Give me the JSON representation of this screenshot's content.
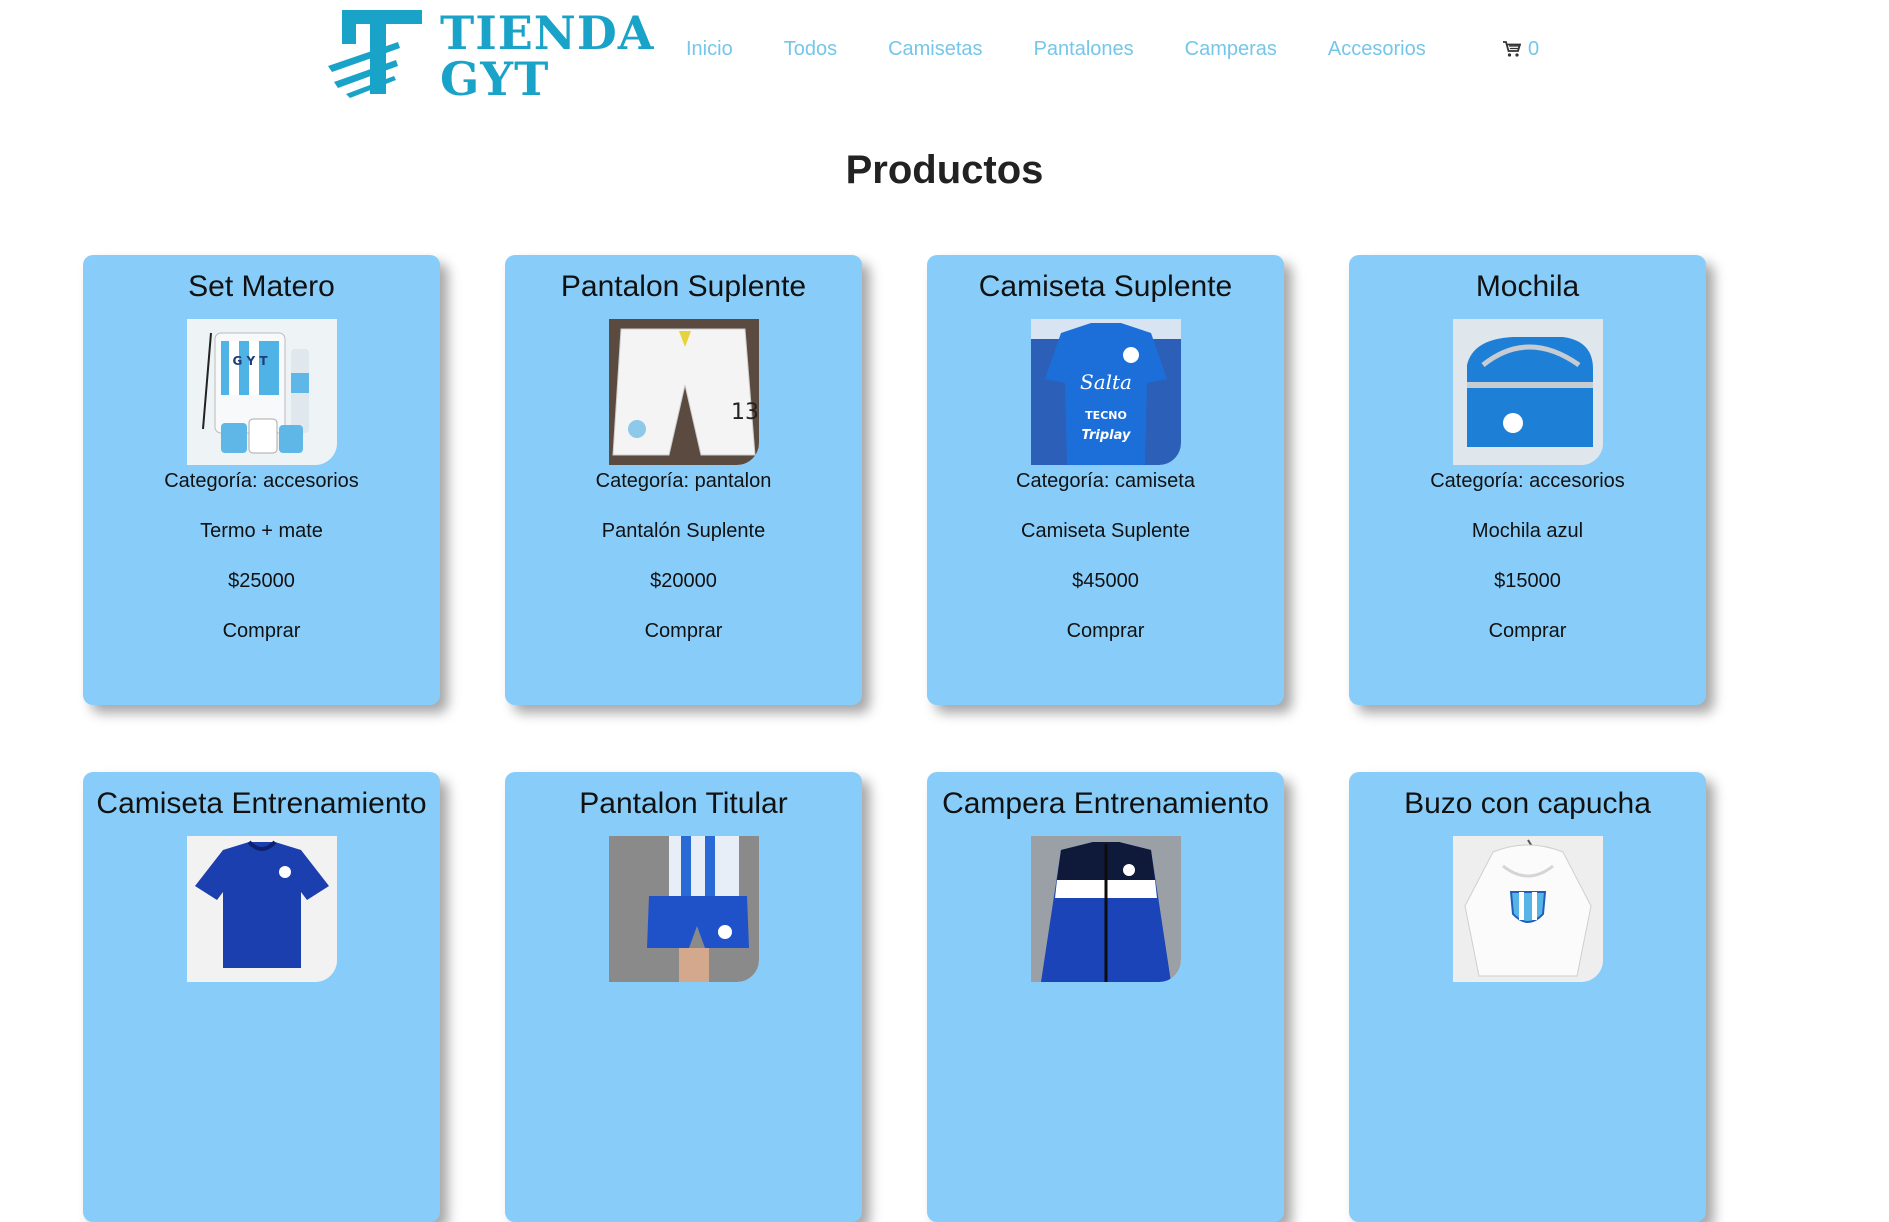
{
  "brand": {
    "line1": "TIENDA",
    "line2": "GYT"
  },
  "nav": [
    {
      "label": "Inicio"
    },
    {
      "label": "Todos"
    },
    {
      "label": "Camisetas"
    },
    {
      "label": "Pantalones"
    },
    {
      "label": "Camperas"
    },
    {
      "label": "Accesorios"
    }
  ],
  "cart": {
    "count": "0",
    "icon": "cart-icon"
  },
  "page_title": "Productos",
  "products": [
    {
      "title": "Set Matero",
      "category": "Categoría: accesorios",
      "description": "Termo + mate",
      "price": "$25000",
      "buy_label": "Comprar",
      "image": "mate-set-image"
    },
    {
      "title": "Pantalon Suplente",
      "category": "Categoría: pantalon",
      "description": "Pantalón Suplente",
      "price": "$20000",
      "buy_label": "Comprar",
      "image": "white-shorts-image"
    },
    {
      "title": "Camiseta Suplente",
      "category": "Categoría: camiseta",
      "description": "Camiseta Suplente",
      "price": "$45000",
      "buy_label": "Comprar",
      "image": "blue-jersey-image"
    },
    {
      "title": "Mochila",
      "category": "Categoría: accesorios",
      "description": "Mochila azul",
      "price": "$15000",
      "buy_label": "Comprar",
      "image": "blue-backpack-image"
    },
    {
      "title": "Camiseta Entrenamiento",
      "image": "training-shirt-image"
    },
    {
      "title": "Pantalon Titular",
      "image": "home-shorts-image"
    },
    {
      "title": "Campera Entrenamiento",
      "image": "training-jacket-image"
    },
    {
      "title": "Buzo con capucha",
      "image": "white-hoodie-image"
    }
  ],
  "colors": {
    "accent": "#1aa3c8",
    "nav": "#74c6ea",
    "card": "#88cdf9"
  }
}
